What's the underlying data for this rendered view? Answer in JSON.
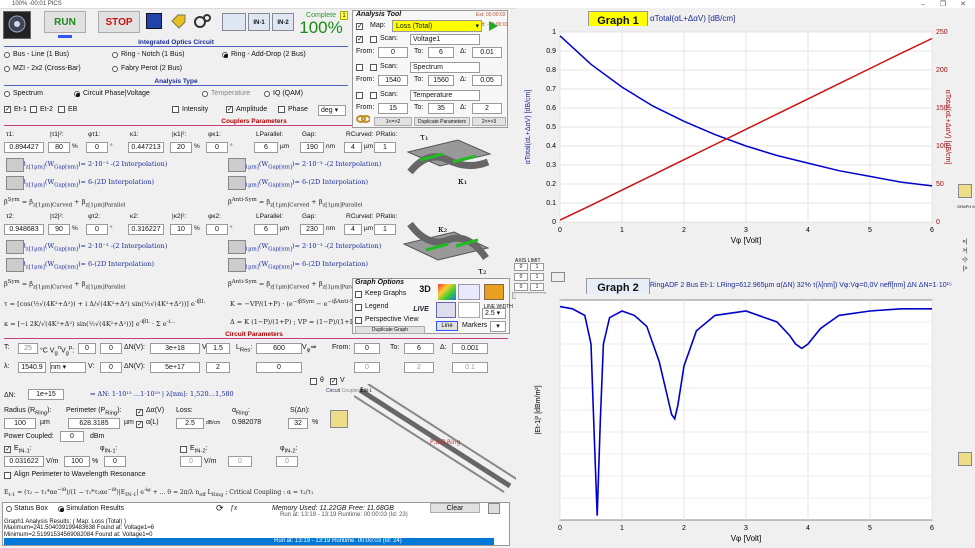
{
  "window": {
    "title": "100% -00:01 PICS"
  },
  "toolbar": {
    "run": "RUN",
    "stop": "STOP",
    "complete_label": "Complete",
    "complete_value": "100%",
    "step": "1"
  },
  "ioc": {
    "header": "Integrated Optics Circuit",
    "options": [
      "Bus - Line (1 Bus)",
      "Ring - Notch (1 Bus)",
      "Ring - Add-Drop (2 Bus)",
      "MZI - 2x2 (Cross-Bar)",
      "Fabry Perot (2 Bus)"
    ],
    "selected": 2
  },
  "analysis_type": {
    "header": "Analysis Type",
    "options": [
      "Spectrum",
      "Circuit Phase|Voltage",
      "Temperature",
      "IQ (QAM)"
    ],
    "selected": 1,
    "outputs": [
      "Et-1",
      "Et-2",
      "EB",
      "Intensity",
      "Amplitude",
      "Phase"
    ],
    "phase_unit": "deg"
  },
  "couplers": {
    "header": "Couplers Parameters",
    "c1": {
      "tau": "0.894427",
      "tau_pct": "80",
      "phase": "0",
      "kappa": "0.447213",
      "kappa_pct": "20",
      "kphase": "0",
      "lpar": "6",
      "lpar_u": "µm",
      "gap": "190",
      "gap_u": "nm",
      "rcurved": "4",
      "rc_u": "µm",
      "pratio": "1"
    },
    "c2": {
      "tau": "0.948683",
      "tau_pct": "90",
      "phase": "0",
      "kappa": "0.316227",
      "kappa_pct": "10",
      "kphase": "0",
      "lpar": "6",
      "lpar_u": "µm",
      "gap": "230",
      "gap_u": "nm",
      "rcurved": "4",
      "rc_u": "µm",
      "pratio": "1"
    },
    "col_labels": [
      "τ1:",
      "|τ1|²:",
      "φτ1:",
      "κ1:",
      "|κ1|²:",
      "φκ1:",
      "LParallel:",
      "Gap:",
      "RCurved:",
      "PRatio:"
    ],
    "col_labels2": [
      "τ2:",
      "|τ2|²:",
      "φτ2:",
      "κ2:",
      "|κ2|²:",
      "φκ2:",
      "LParallel:",
      "Gap:",
      "RCurved:",
      "PRatio:"
    ],
    "interp1": "= 2·10⁻³ -(2 Interpolation)",
    "interp2": "= 6-(2D Interpolation)"
  },
  "circuit": {
    "header": "Circuit Parameters",
    "T": "25",
    "T_unit": "°C",
    "vg": "0",
    "vgb": "0",
    "dN": "3e+18",
    "V": "1.5",
    "lambda_res": "600",
    "Vphi_from": "0",
    "Vphi_to": "6",
    "Vphi_step": "0.001",
    "lambda": "1540.9",
    "lambda_unit": "nm",
    "r1": "0",
    "dV": "5e+17",
    "V2": "2",
    "Vphi2": "0",
    "V2_from": "0",
    "V2_to": "2",
    "V2_step": "0.1",
    "dN_label": "ΔN:",
    "dN_val": "1e+15",
    "radius": "100",
    "radius_u": "µm",
    "perim": "628.3185",
    "perim_u": "µm",
    "loss": "2.5",
    "loss_u": "dB/cm",
    "alpha_ring": "0.982078",
    "S": "32",
    "S_u": "%",
    "power_label": "Power Coupled:",
    "power": "0",
    "power_u": "dBm",
    "Ein1": "0.031622",
    "Ein1_u": "V/m",
    "Ein1_pct": "100",
    "Ein2": "0",
    "Ein2_u": "V/m",
    "Ein2_pct": "0",
    "align": "Align Perimeter to Wavelength Resonance",
    "circuit_tab": "Circuit",
    "couplers_tab": "Couplers"
  },
  "analysis_tool": {
    "title": "Analysis Tool",
    "map_label": "Map:",
    "map_value": "Loss (Total)",
    "est": "Est:",
    "est_val": "00:00:02",
    "left": "Left:",
    "left_val": "-00:00:01",
    "scans": [
      {
        "label": "Voltage1",
        "from": "0",
        "to": "6",
        "delta": "0.01",
        "checked": true
      },
      {
        "label": "Spectrum",
        "from": "1540",
        "to": "1560",
        "delta": "0.05",
        "checked": false
      },
      {
        "label": "Temperature",
        "from": "15",
        "to": "35",
        "delta": "2",
        "checked": false
      }
    ],
    "dup": "Duplicate Parameters",
    "b12": "1<=>2",
    "b23": "2<=>3"
  },
  "graph_options": {
    "title": "Graph Options",
    "keep": "Keep Graphs",
    "legend": "Legend",
    "perspective": "Perspective View",
    "dup": "Duplicate Graph",
    "live": "LIVE",
    "line": "Line",
    "markers": "Markers",
    "line_width": "2.5",
    "axis_limit": "AXIS LIMIT",
    "update": "Update Colorbar"
  },
  "status": {
    "tab1": "Status Box",
    "tab2": "Simulation Results",
    "memory": "Memory Used: 11.22GB  Free: 11.68GB",
    "clear": "Clear",
    "lines": [
      "Run at: 13:19 - 13:19   Runtime: 00:00:03   (Id: 23)",
      "Graph1 Analysis Results: ( Map: Loss (Total) )",
      "Maximum=241.504039199483638  Found at: Voltage1=6",
      "Minimum=2.51991534569082084   Found at: Voltage1=0",
      "Run at: 13:19 - 13:19   Runtime: 00:00:03   (Id: 24)"
    ]
  },
  "graph1": {
    "label": "Graph 1",
    "ylabel_left": "αTotal(αL+ΔαV) [dB/cm]",
    "ylabel_right": "αTotal(αL+ΔαV) [dB/cm]",
    "xlabel": "Vφ [Volt]",
    "title_expr": "αTotal(αL+ΔαV) [dB/cm]"
  },
  "graph2": {
    "label": "Graph 2",
    "xlabel": "Vφ [Volt]",
    "ylabel": "|Et-1|² [dBm/m²]",
    "info": "RingADF 2 Bus  Et-1: LRing=612.965µm  α(ΔN) 32%  τ(λ[nm])  Vφ:Vφ=0,0V  neff[nm] ΔN ΔN=1·10¹⁵"
  },
  "chart_data": [
    {
      "type": "line",
      "title": "",
      "xlabel": "Vφ [Volt]",
      "ylabel": "αTotal(αL+ΔαV) [dB/cm]",
      "xlim": [
        0,
        6
      ],
      "ylim_left": [
        0,
        1
      ],
      "ylim_right": [
        0,
        250
      ],
      "x": [
        0,
        0.5,
        1,
        1.5,
        2,
        2.5,
        3,
        3.5,
        4,
        4.5,
        5,
        5.5,
        6
      ],
      "series": [
        {
          "axis": "left",
          "color": "#0000cc",
          "values": [
            0.98,
            0.83,
            0.71,
            0.61,
            0.53,
            0.46,
            0.4,
            0.35,
            0.31,
            0.27,
            0.24,
            0.21,
            0.19
          ]
        },
        {
          "axis": "right",
          "color": "#cc1111",
          "values": [
            2.5,
            22,
            42,
            62,
            82,
            102,
            122,
            142,
            162,
            182,
            202,
            222,
            241.5
          ]
        }
      ],
      "xticks": [
        0,
        1,
        2,
        3,
        4,
        5,
        6
      ],
      "yticks_left": [
        0,
        0.1,
        0.2,
        0.3,
        0.4,
        0.5,
        0.6,
        0.7,
        0.8,
        0.9,
        1
      ],
      "yticks_right": [
        0,
        50,
        100,
        150,
        200,
        250
      ]
    },
    {
      "type": "line",
      "title": "",
      "xlabel": "Vφ [Volt]",
      "ylabel": "|Et-1|² [dBm/m²]",
      "xlim": [
        0,
        6
      ],
      "x": [
        0,
        0.2,
        0.4,
        0.5,
        0.55,
        0.6,
        0.65,
        0.7,
        0.8,
        1,
        1.2,
        1.4,
        1.6,
        1.7,
        1.8,
        1.85,
        1.9,
        2,
        2.2,
        2.5,
        3,
        3.5,
        3.7,
        3.8,
        3.9,
        4,
        4.2,
        4.5,
        5,
        5.5,
        6
      ],
      "series": [
        {
          "color": "#0000cc",
          "values": [
            0.97,
            0.96,
            0.93,
            0.8,
            0.4,
            0.02,
            0.45,
            0.8,
            0.92,
            0.95,
            0.93,
            0.88,
            0.72,
            0.6,
            0.48,
            0.46,
            0.52,
            0.7,
            0.86,
            0.93,
            0.95,
            0.9,
            0.84,
            0.8,
            0.78,
            0.8,
            0.87,
            0.93,
            0.95,
            0.96,
            0.96
          ]
        }
      ],
      "xticks": [
        0,
        1,
        2,
        3,
        4,
        5,
        6
      ]
    }
  ]
}
